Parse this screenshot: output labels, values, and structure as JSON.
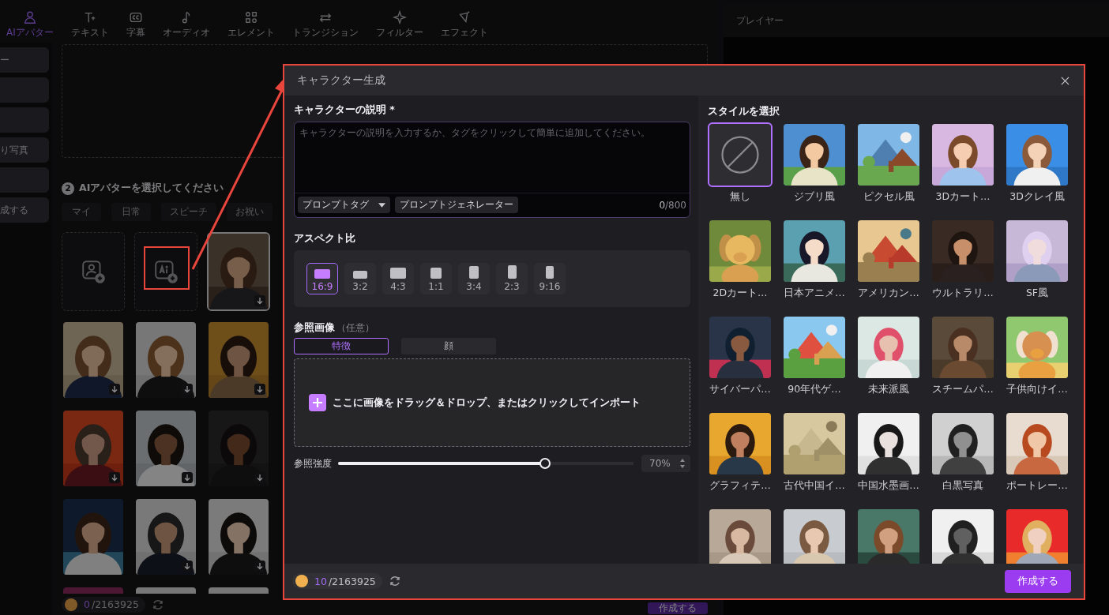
{
  "toolbar": {
    "tabs": [
      {
        "label": "AIアバター",
        "selected": true
      },
      {
        "label": "テキスト",
        "selected": false
      },
      {
        "label": "字幕",
        "selected": false
      },
      {
        "label": "オーディオ",
        "selected": false
      },
      {
        "label": "エレメント",
        "selected": false
      },
      {
        "label": "トランジション",
        "selected": false
      },
      {
        "label": "フィルター",
        "selected": false
      },
      {
        "label": "エフェクト",
        "selected": false
      }
    ]
  },
  "sidebar": {
    "items": [
      {
        "label": "ー"
      },
      {
        "label": "り写真"
      },
      {
        "label": "成する"
      }
    ]
  },
  "avatar_panel": {
    "step": "2",
    "heading": "AIアバターを選択してください",
    "categories": [
      {
        "label": "マイ",
        "selected": false
      },
      {
        "label": "日常",
        "selected": false
      },
      {
        "label": "スピーチ",
        "selected": false
      },
      {
        "label": "お祝い",
        "selected": false
      }
    ],
    "avatars": [
      {
        "kind": "upload"
      },
      {
        "kind": "ai-create"
      },
      {
        "kind": "picture",
        "selected": true,
        "download": true
      },
      {
        "kind": "picture",
        "selected": false,
        "download": true
      },
      {
        "kind": "picture",
        "selected": false,
        "download": true
      },
      {
        "kind": "picture",
        "selected": false,
        "download": true
      },
      {
        "kind": "picture",
        "selected": false,
        "download": true
      },
      {
        "kind": "picture",
        "selected": false,
        "download": true
      },
      {
        "kind": "picture",
        "selected": false,
        "download": true
      },
      {
        "kind": "picture",
        "selected": false,
        "download": false
      },
      {
        "kind": "picture",
        "selected": false,
        "download": true
      },
      {
        "kind": "picture",
        "selected": false,
        "download": true
      },
      {
        "kind": "picture",
        "selected": false,
        "download": false
      },
      {
        "kind": "picture",
        "selected": false,
        "download": false
      },
      {
        "kind": "picture",
        "selected": false,
        "download": false
      }
    ],
    "credits": {
      "used": "0",
      "total": "/2163925"
    },
    "create_button": "作成する"
  },
  "player": {
    "title": "プレイヤー"
  },
  "dialog": {
    "title": "キャラクター生成",
    "description": {
      "label": "キャラクターの説明 *",
      "placeholder": "キャラクターの説明を入力するか、タグをクリックして簡単に追加してください。",
      "tag_button": "プロンプトタグ",
      "generator_button": "プロンプトジェネレーター",
      "count": "0",
      "limit": "/800"
    },
    "aspect": {
      "label": "アスペクト比",
      "options": [
        {
          "label": "16:9",
          "selected": true
        },
        {
          "label": "3:2",
          "selected": false
        },
        {
          "label": "4:3",
          "selected": false
        },
        {
          "label": "1:1",
          "selected": false
        },
        {
          "label": "3:4",
          "selected": false
        },
        {
          "label": "2:3",
          "selected": false
        },
        {
          "label": "9:16",
          "selected": false
        }
      ]
    },
    "reference": {
      "label": "参照画像",
      "note": "（任意）",
      "modes": [
        {
          "label": "特徴",
          "selected": true
        },
        {
          "label": "顔",
          "selected": false
        }
      ],
      "drop_text": "ここに画像をドラッグ＆ドロップ、またはクリックしてインポート",
      "strength_label": "参照強度",
      "level": 0.7,
      "reading": "70%"
    },
    "styles": {
      "label": "スタイルを選択",
      "items": [
        {
          "label": "無し",
          "kind": "none",
          "selected": true
        },
        {
          "label": "ジブリ風",
          "kind": "picture",
          "selected": false
        },
        {
          "label": "ピクセル風",
          "kind": "picture",
          "selected": false
        },
        {
          "label": "3Dカート…",
          "kind": "picture",
          "selected": false
        },
        {
          "label": "3Dクレイ風",
          "kind": "picture",
          "selected": false
        },
        {
          "label": "2Dカート…",
          "kind": "picture",
          "selected": false
        },
        {
          "label": "日本アニメ…",
          "kind": "picture",
          "selected": false
        },
        {
          "label": "アメリカン…",
          "kind": "picture",
          "selected": false
        },
        {
          "label": "ウルトラリ…",
          "kind": "picture",
          "selected": false
        },
        {
          "label": "SF風",
          "kind": "picture",
          "selected": false
        },
        {
          "label": "サイバーパ…",
          "kind": "picture",
          "selected": false
        },
        {
          "label": "90年代ゲ…",
          "kind": "picture",
          "selected": false
        },
        {
          "label": "未来派風",
          "kind": "picture",
          "selected": false
        },
        {
          "label": "スチームパ…",
          "kind": "picture",
          "selected": false
        },
        {
          "label": "子供向けイ…",
          "kind": "picture",
          "selected": false
        },
        {
          "label": "グラフィテ…",
          "kind": "picture",
          "selected": false
        },
        {
          "label": "古代中国イ…",
          "kind": "picture",
          "selected": false
        },
        {
          "label": "中国水墨画…",
          "kind": "picture",
          "selected": false
        },
        {
          "label": "白黒写真",
          "kind": "picture",
          "selected": false
        },
        {
          "label": "ポートレー…",
          "kind": "picture",
          "selected": false
        },
        {
          "kind": "picture",
          "selected": false
        },
        {
          "kind": "picture",
          "selected": false
        },
        {
          "kind": "picture",
          "selected": false
        },
        {
          "kind": "picture",
          "selected": false
        },
        {
          "kind": "picture",
          "selected": false
        }
      ]
    },
    "credits": {
      "used": "10",
      "total": "/2163925"
    },
    "create_button": "作成する"
  }
}
